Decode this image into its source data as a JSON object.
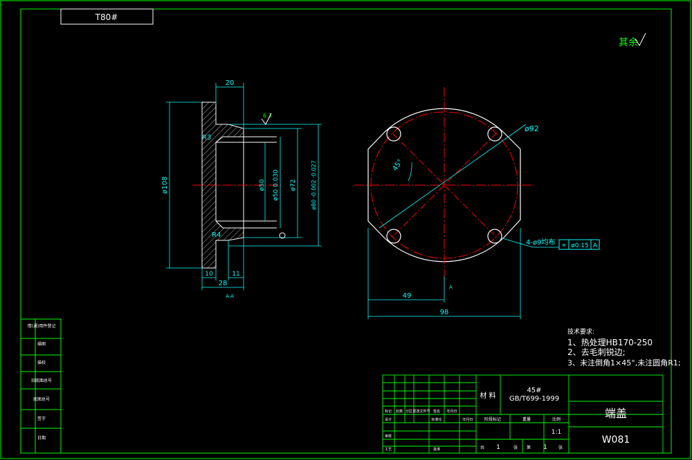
{
  "drawing": {
    "title_box": "T80#",
    "top_right_note": "其余",
    "section_label": "A-A",
    "colors": {
      "frame": "#00ff00",
      "outline": "#ffffff",
      "dimension": "#00ffff",
      "centerline": "#ff0000",
      "text": "#ffffff"
    }
  },
  "section_view": {
    "dims": {
      "d20": "20",
      "d10": "10",
      "d28": "28",
      "d11": "11",
      "dia108": "ø108",
      "dia50": "ø50",
      "dia50_tol": "ø50 0.030",
      "dia72": "ø72",
      "dia80": "ø80 -0.002 -0.027",
      "r3": "R3",
      "r4": "R4",
      "roughness_note": "6.3"
    }
  },
  "front_view": {
    "dims": {
      "dia92": "ø92",
      "angle45": "45°",
      "d49": "49",
      "d98": "98",
      "holes": "4-ø9均布",
      "tolerance_sym": "⌖",
      "tolerance_val": "ø0.15",
      "tolerance_ref": "A",
      "datum": "A"
    }
  },
  "tech_requirements": {
    "title": "技术要求:",
    "items": [
      "1、热处理HB170-250",
      "2、去毛刺锐边;",
      "3、未注倒角1×45°,未注圆角R1;"
    ]
  },
  "title_block": {
    "material_label": "材 料",
    "material": "45#",
    "standard": "GB/T699-1999",
    "part_name": "端盖",
    "drawing_no": "W081",
    "scale": "1:1",
    "sheet_total": "1",
    "sheet_no": "1",
    "header_row": [
      "标记",
      "处数",
      "分区",
      "更改文件号",
      "签名",
      "年月日"
    ],
    "design_row": [
      "设计",
      "",
      "",
      "标准化",
      "",
      "年月日"
    ],
    "stage_headers": [
      "阶段标记",
      "重量",
      "比例"
    ],
    "approve_labels": [
      "审核",
      "工艺",
      "批准"
    ],
    "sheet_labels": [
      "共",
      "张",
      "第",
      "张"
    ]
  },
  "side_table": {
    "rows": [
      "借(通)用件登记",
      "描图",
      "描校",
      "旧底图总号",
      "底图总号",
      "签字",
      "日期"
    ]
  }
}
